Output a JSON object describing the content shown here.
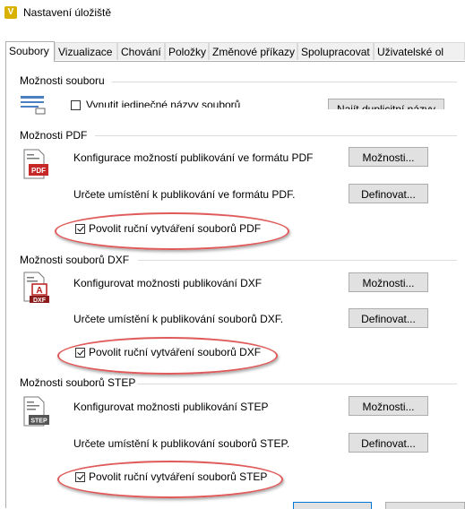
{
  "window": {
    "title": "Nastavení úložiště",
    "app_icon": "V"
  },
  "tabs": [
    {
      "label": "Soubory",
      "active": true
    },
    {
      "label": "Vizualizace"
    },
    {
      "label": "Chování"
    },
    {
      "label": "Položky"
    },
    {
      "label": "Změnové příkazy"
    },
    {
      "label": "Spolupracovat"
    },
    {
      "label": "Uživatelské ol"
    }
  ],
  "file_options": {
    "label": "Možnosti souboru",
    "unique_names_label": "Vynutit jedinečné názvy souborů",
    "unique_names_checked": false,
    "find_duplicates_label": "Najít duplicitní názvy"
  },
  "pdf": {
    "label": "Možnosti PDF",
    "icon_text": "PDF",
    "configure_text": "Konfigurace možností publikování ve formátu PDF",
    "options_button": "Možnosti...",
    "location_text": "Určete umístění k publikování ve formátu PDF.",
    "define_button": "Definovat...",
    "manual_label": "Povolit ruční vytváření souborů PDF",
    "manual_checked": true
  },
  "dxf": {
    "label": "Možnosti souborů DXF",
    "icon_text": "DXF",
    "configure_text": "Konfigurovat možnosti publikování DXF",
    "options_button": "Možnosti...",
    "location_text": "Určete umístění k publikování souborů DXF.",
    "define_button": "Definovat...",
    "manual_label": "Povolit ruční vytváření souborů DXF",
    "manual_checked": true
  },
  "step": {
    "label": "Možnosti souborů STEP",
    "icon_text": "STEP",
    "configure_text": "Konfigurovat možnosti publikování STEP",
    "options_button": "Možnosti...",
    "location_text": "Určete umístění k publikování souborů STEP.",
    "define_button": "Definovat...",
    "manual_label": "Povolit ruční vytváření souborů STEP",
    "manual_checked": true
  },
  "colors": {
    "highlight": "#e05a5a",
    "pdf_red": "#c62828",
    "dxf_red": "#b71c1c"
  }
}
